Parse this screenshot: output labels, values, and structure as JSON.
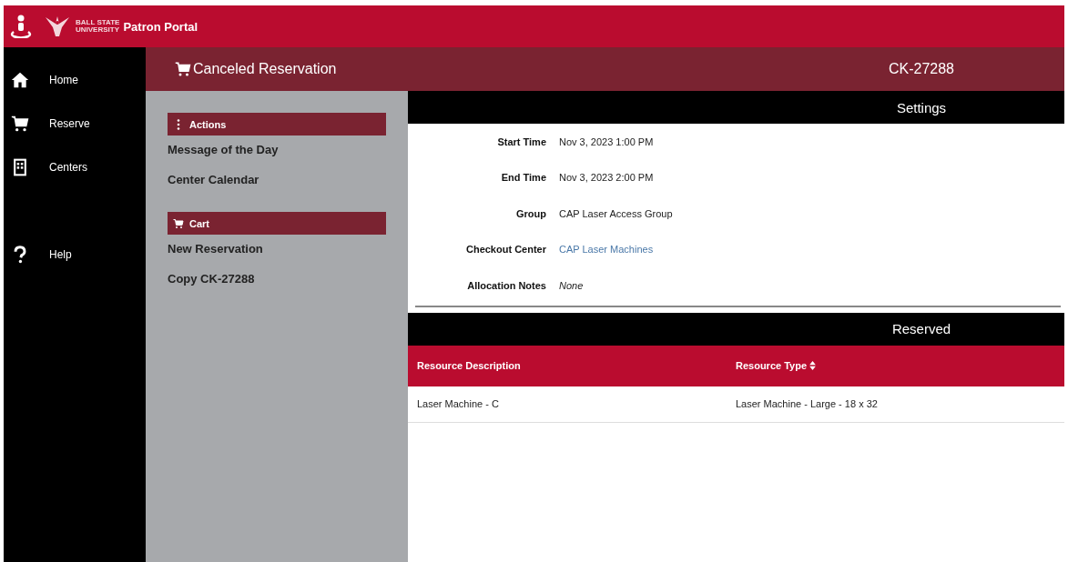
{
  "app": {
    "university": "BALL STATE",
    "university_line2": "UNIVERSITY",
    "title": "Patron Portal"
  },
  "nav": [
    {
      "label": "Home",
      "kind": "home"
    },
    {
      "label": "Reserve",
      "kind": "cart"
    },
    {
      "label": "Centers",
      "kind": "building"
    },
    {
      "label": "Help",
      "kind": "help"
    }
  ],
  "header": {
    "title": "Canceled Reservation",
    "id": "CK-27288"
  },
  "panels": [
    {
      "title": "Actions",
      "kind": "menu",
      "links": [
        "Message of the Day",
        "Center Calendar"
      ]
    },
    {
      "title": "Cart",
      "kind": "cart",
      "links": [
        "New Reservation",
        "Copy CK-27288"
      ]
    }
  ],
  "settings": {
    "title": "Settings",
    "fields": [
      {
        "label": "Start Time",
        "value": "Nov 3, 2023 1:00 PM",
        "kind": "text"
      },
      {
        "label": "End Time",
        "value": "Nov 3, 2023 2:00 PM",
        "kind": "text"
      },
      {
        "label": "Group",
        "value": "CAP Laser Access Group",
        "kind": "text"
      },
      {
        "label": "Checkout Center",
        "value": "CAP Laser Machines",
        "kind": "link"
      },
      {
        "label": "Allocation Notes",
        "value": "None",
        "kind": "empty"
      }
    ]
  },
  "reserved": {
    "title": "Reserved",
    "columns": [
      {
        "label": "Resource Description",
        "sortable": false
      },
      {
        "label": "Resource Type",
        "sortable": true
      }
    ],
    "rows": [
      [
        "Laser Machine - C",
        "Laser Machine - Large - 18 x 32"
      ]
    ]
  }
}
